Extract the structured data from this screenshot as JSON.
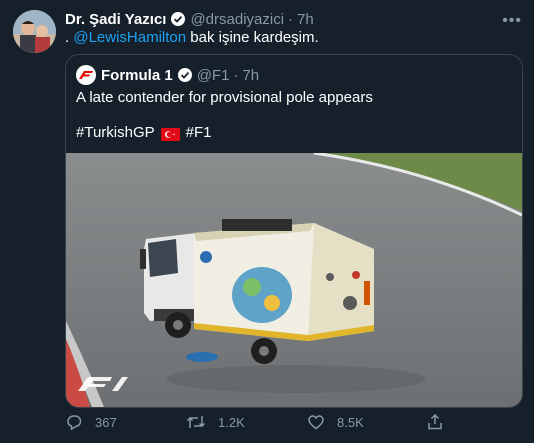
{
  "tweet": {
    "author_name": "Dr. Şadi Yazıcı",
    "author_handle": "@drsadiyazici",
    "separator": "·",
    "time": "7h",
    "text_prefix": ". ",
    "mention": "@LewisHamilton",
    "text_suffix": " bak işine kardeşim.",
    "menu_label": "•••"
  },
  "quoted": {
    "author_name": "Formula 1",
    "author_handle": "@F1",
    "separator": "·",
    "time": "7h",
    "text": "A late contender for provisional pole appears",
    "hashtag_1": "#TurkishGP",
    "hashtag_2": "#F1",
    "media_alt": "Street sweeper truck on wet race track"
  },
  "actions": {
    "replies": "367",
    "retweets": "1.2K",
    "likes": "8.5K"
  },
  "colors": {
    "background": "#15202b",
    "accent": "#1da1f2",
    "muted": "#8899a6",
    "border": "#38444d"
  }
}
